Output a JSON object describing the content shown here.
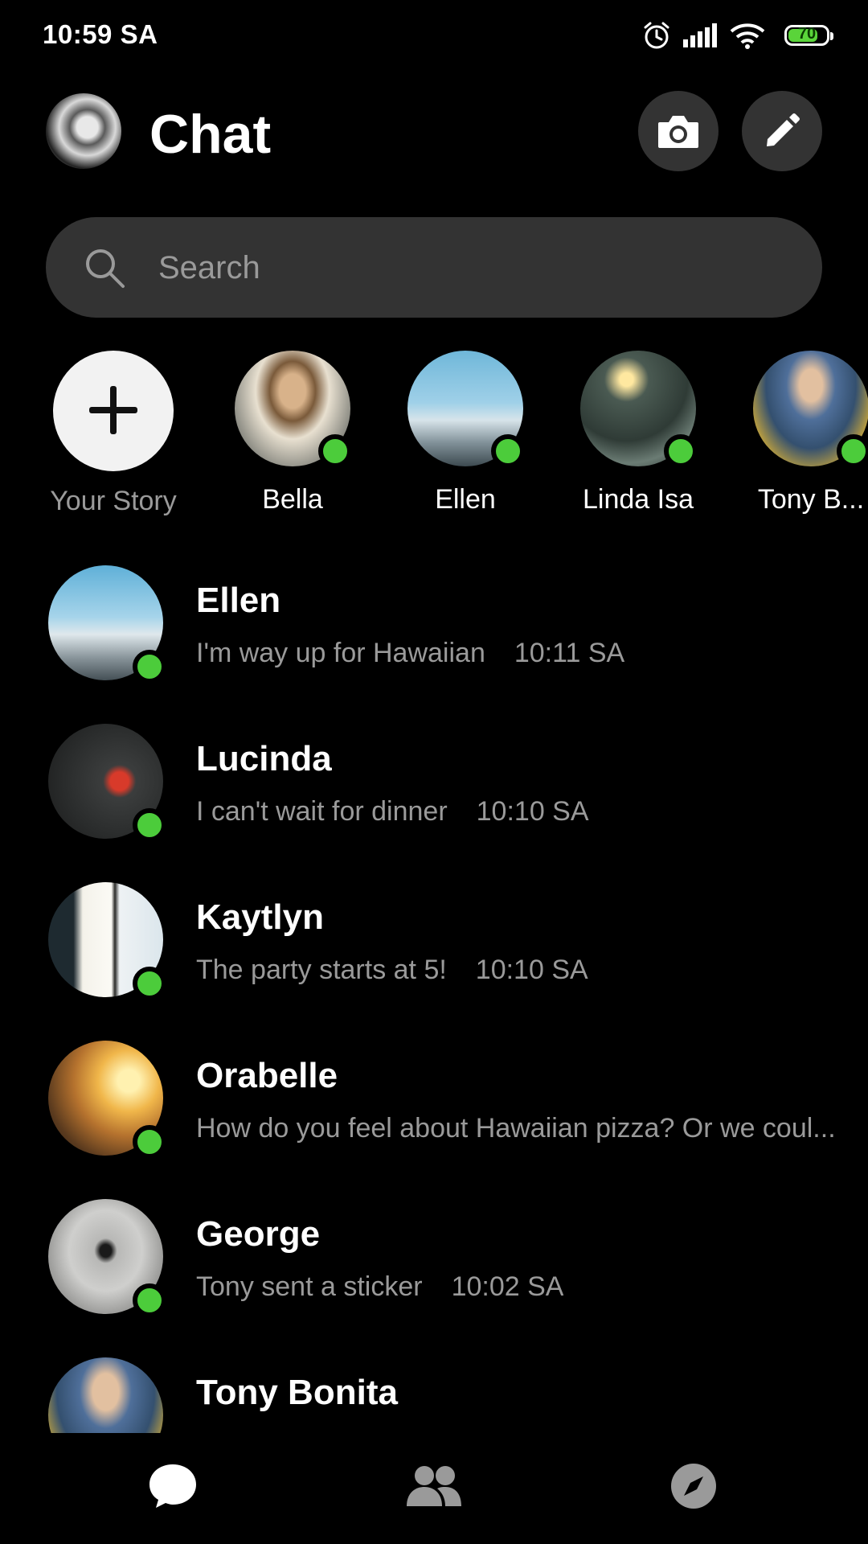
{
  "status_bar": {
    "time": "10:59 SA",
    "battery_level": "70",
    "icons": [
      "alarm-icon",
      "signal-icon",
      "wifi-icon",
      "battery-icon"
    ]
  },
  "header": {
    "title": "Chat",
    "buttons": [
      "camera-icon",
      "compose-icon"
    ]
  },
  "search": {
    "placeholder": "Search"
  },
  "stories": [
    {
      "name": "Your Story"
    },
    {
      "name": "Bella",
      "online": true
    },
    {
      "name": "Ellen",
      "online": true
    },
    {
      "name": "Linda Isa",
      "online": true
    },
    {
      "name": "Tony B...",
      "online": true
    }
  ],
  "chats": [
    {
      "name": "Ellen",
      "message": "I'm way up for Hawaiian",
      "time": "10:11 SA",
      "online": true
    },
    {
      "name": "Lucinda",
      "message": "I can't wait for dinner",
      "time": "10:10 SA",
      "online": true
    },
    {
      "name": "Kaytlyn",
      "message": "The party starts at 5!",
      "time": "10:10 SA",
      "online": true
    },
    {
      "name": "Orabelle",
      "message": "How do you feel about Hawaiian pizza? Or we coul...",
      "time": "",
      "online": true
    },
    {
      "name": "George",
      "message": "Tony sent a sticker",
      "time": "10:02 SA",
      "online": true
    },
    {
      "name": "Tony Bonita",
      "message": "",
      "time": "",
      "online": false
    }
  ],
  "bottom_nav": [
    "chat-icon",
    "people-icon",
    "discover-icon"
  ],
  "colors": {
    "background": "#000000",
    "surface": "#333333",
    "online": "#4ccc3b",
    "secondary_text": "#9a9a9a"
  }
}
